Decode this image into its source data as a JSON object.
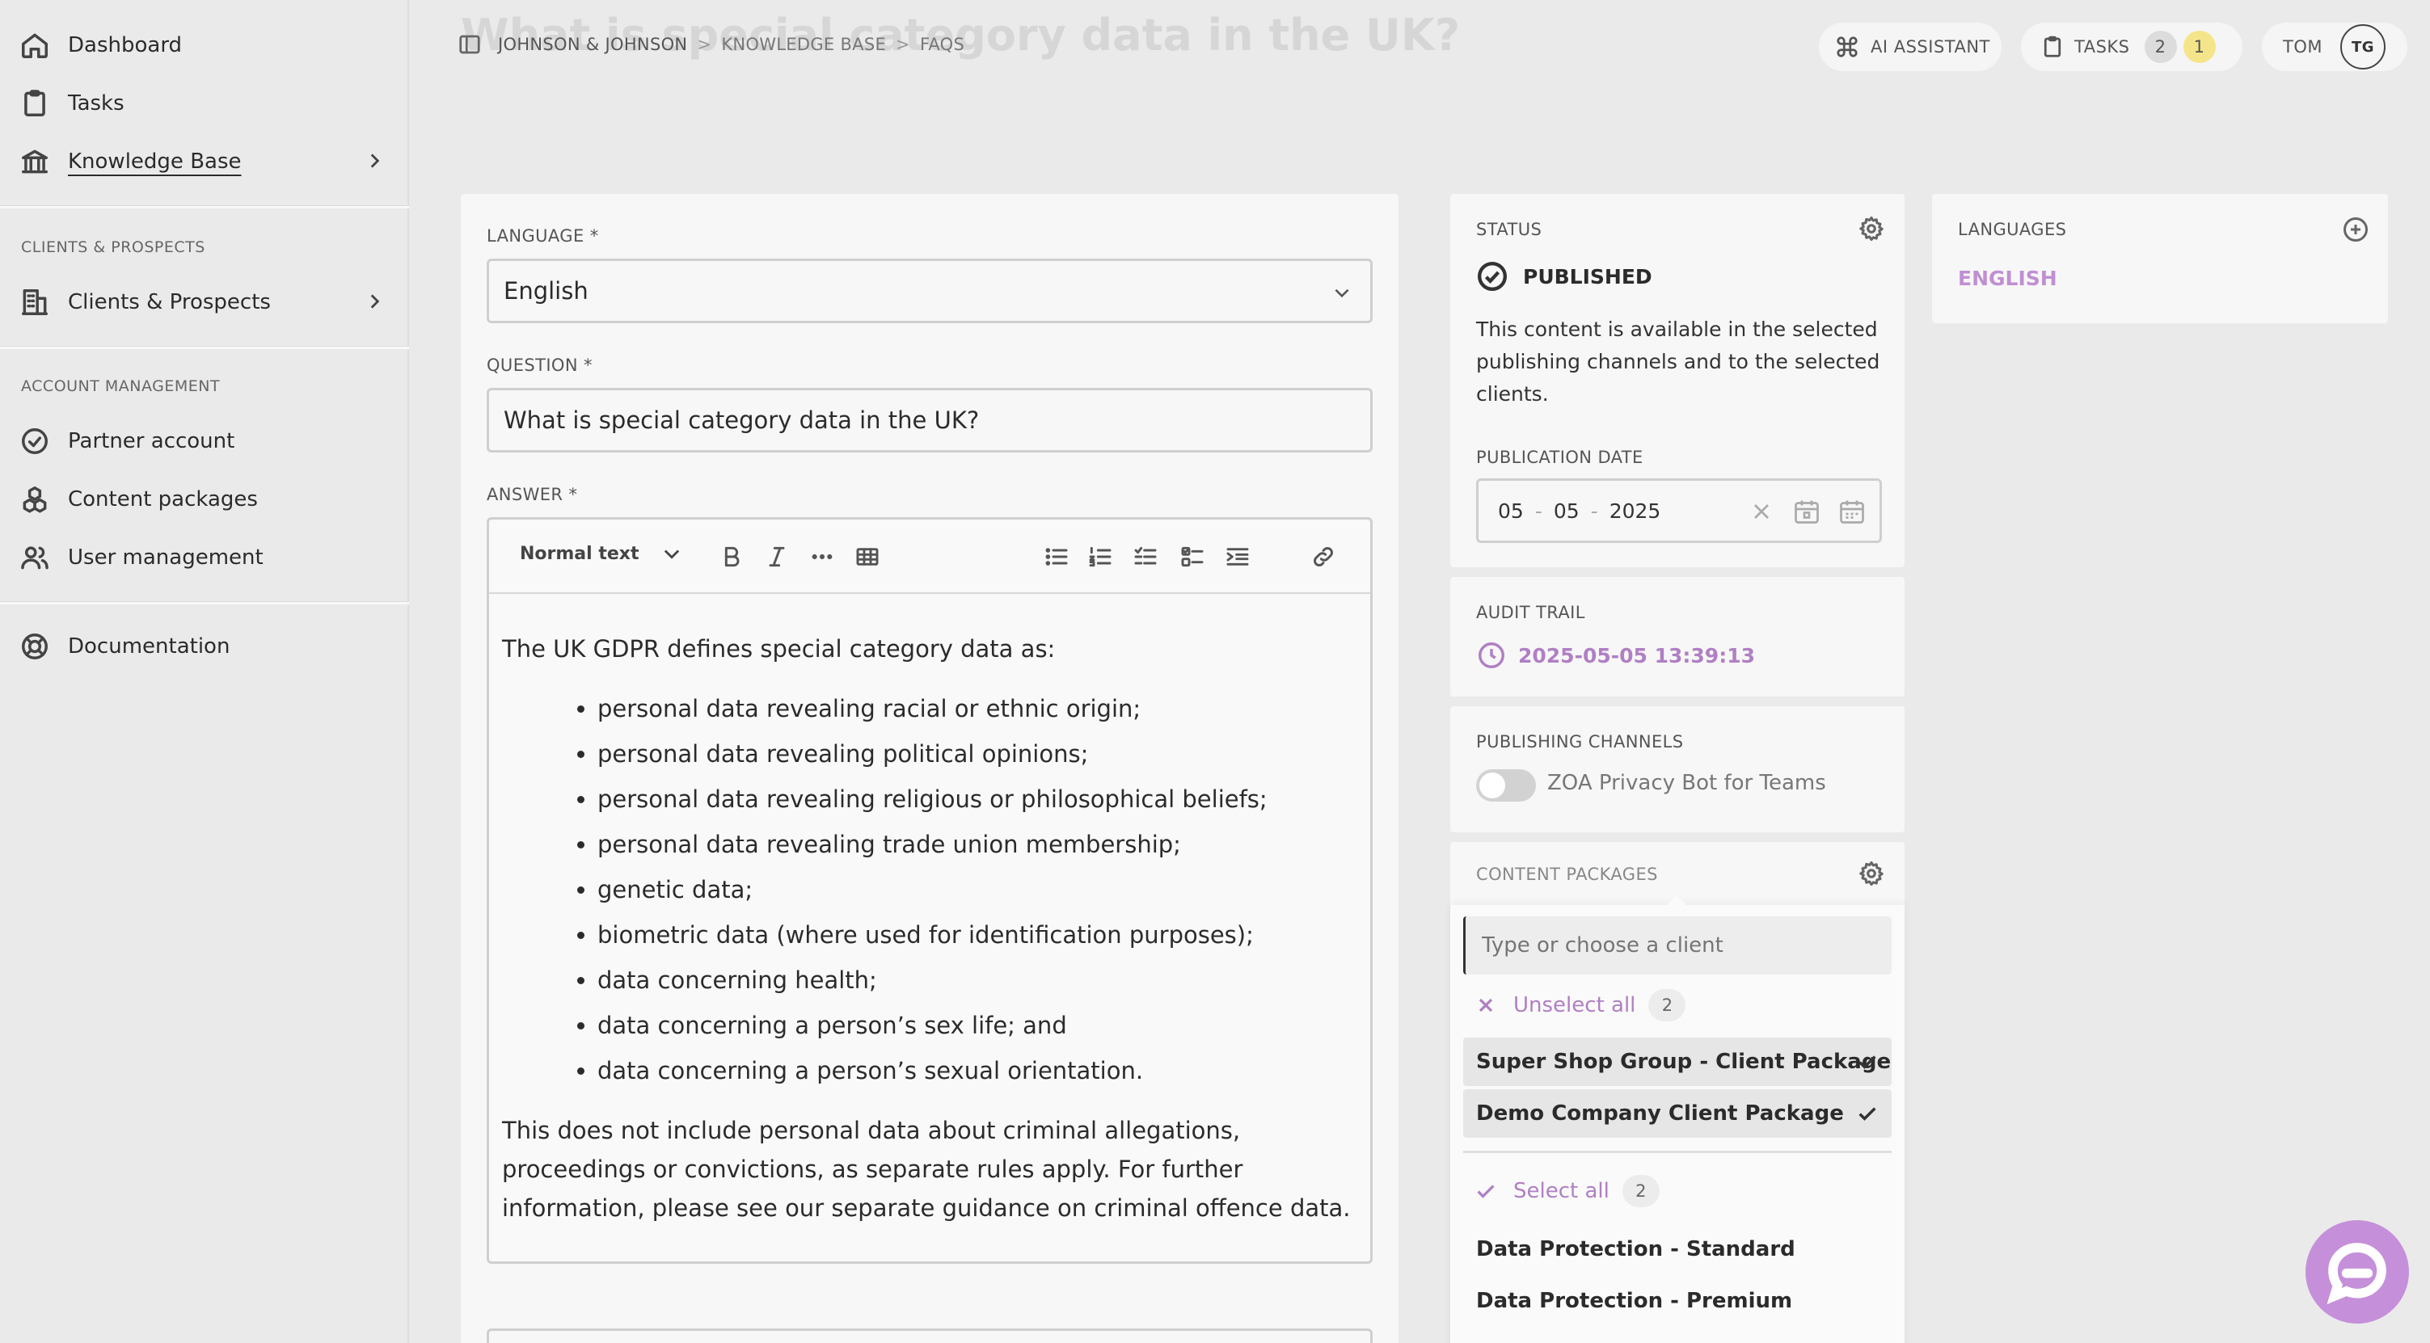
{
  "sidebar": {
    "items": [
      {
        "label": "Dashboard",
        "icon": "home-icon"
      },
      {
        "label": "Tasks",
        "icon": "clipboard-icon"
      },
      {
        "label": "Knowledge Base",
        "icon": "bank-icon"
      }
    ],
    "clients_heading": "CLIENTS & PROSPECTS",
    "clients_item": "Clients & Prospects",
    "account_heading": "ACCOUNT MANAGEMENT",
    "account_items": [
      {
        "label": "Partner account"
      },
      {
        "label": "Content packages"
      },
      {
        "label": "User management"
      }
    ],
    "documentation": "Documentation"
  },
  "header": {
    "ghost_title": "What is special category data in the UK?",
    "breadcrumb": [
      "JOHNSON & JOHNSON",
      "KNOWLEDGE BASE",
      "FAQS"
    ],
    "breadcrumb_sep": ">",
    "ai_assistant": "AI ASSISTANT",
    "tasks_label": "TASKS",
    "tasks_count_a": "2",
    "tasks_count_b": "1",
    "user_name": "TOM",
    "user_initials": "TG"
  },
  "form": {
    "language_label": "LANGUAGE",
    "language_value": "English",
    "question_label": "QUESTION",
    "question_value": "What is special category data in the UK?",
    "answer_label": "ANSWER",
    "required_mark": "*",
    "toolbar_style": "Normal text",
    "answer_intro": "The UK GDPR defines special category data as:",
    "answer_list": [
      "personal data revealing racial or ethnic origin;",
      "personal data revealing political opinions;",
      "personal data revealing religious or philosophical beliefs;",
      "personal data revealing trade union membership;",
      "genetic data;",
      "biometric data (where used for identification purposes);",
      "data concerning health;",
      "data concerning a person’s sex life; and",
      "data concerning a person’s sexual orientation."
    ],
    "answer_tail": "This does not include personal data about criminal allegations, proceedings or convictions, as separate rules apply. For further information, please see our separate guidance on criminal offence data."
  },
  "status": {
    "title": "STATUS",
    "state": "PUBLISHED",
    "description": "This content is available in the selected publishing channels and to the selected clients.",
    "pub_date_label": "PUBLICATION DATE",
    "day": "05",
    "month": "05",
    "year": "2025",
    "date_sep": "-"
  },
  "audit": {
    "title": "AUDIT TRAIL",
    "timestamp": "2025-05-05 13:39:13"
  },
  "channels": {
    "title": "PUBLISHING CHANNELS",
    "channel_name": "ZOA Privacy Bot for Teams",
    "enabled": false
  },
  "packages": {
    "title": "CONTENT PACKAGES",
    "search_placeholder": "Type or choose a client",
    "unselect_all": "Unselect all",
    "selected_count": "2",
    "selected": [
      "Super Shop Group - Client Package",
      "Demo Company Client Package"
    ],
    "select_all": "Select all",
    "available_count": "2",
    "available": [
      "Data Protection - Standard",
      "Data Protection - Premium"
    ]
  },
  "languages": {
    "title": "LANGUAGES",
    "items": [
      "ENGLISH"
    ]
  },
  "colors": {
    "accent": "#b07fc4",
    "fab": "#c58fda",
    "badge_yellow": "#f4e58a"
  }
}
